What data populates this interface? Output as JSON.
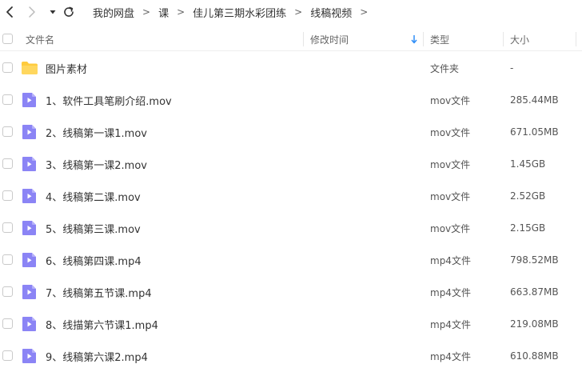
{
  "breadcrumb": [
    "我的网盘",
    "课",
    "佳儿第三期水彩团练",
    "线稿视频"
  ],
  "breadcrumb_sep": ">",
  "columns": {
    "name": "文件名",
    "modified": "修改时间",
    "type": "类型",
    "size": "大小"
  },
  "sort_column": "modified",
  "colors": {
    "folder": "#ffcb3d",
    "video": "#8b84f5",
    "sort_arrow": "#2f8ef7"
  },
  "files": [
    {
      "name": "图片素材",
      "type": "文件夹",
      "size": "-",
      "icon": "folder-icon"
    },
    {
      "name": "1、软件工具笔刷介绍.mov",
      "type": "mov文件",
      "size": "285.44MB",
      "icon": "video-file-icon"
    },
    {
      "name": "2、线稿第一课1.mov",
      "type": "mov文件",
      "size": "671.05MB",
      "icon": "video-file-icon"
    },
    {
      "name": "3、线稿第一课2.mov",
      "type": "mov文件",
      "size": "1.45GB",
      "icon": "video-file-icon"
    },
    {
      "name": "4、线稿第二课.mov",
      "type": "mov文件",
      "size": "2.52GB",
      "icon": "video-file-icon"
    },
    {
      "name": "5、线稿第三课.mov",
      "type": "mov文件",
      "size": "2.15GB",
      "icon": "video-file-icon"
    },
    {
      "name": "6、线稿第四课.mp4",
      "type": "mp4文件",
      "size": "798.52MB",
      "icon": "video-file-icon"
    },
    {
      "name": "7、线稿第五节课.mp4",
      "type": "mp4文件",
      "size": "663.87MB",
      "icon": "video-file-icon"
    },
    {
      "name": "8、线描第六节课1.mp4",
      "type": "mp4文件",
      "size": "219.08MB",
      "icon": "video-file-icon"
    },
    {
      "name": "9、线稿第六课2.mp4",
      "type": "mp4文件",
      "size": "610.88MB",
      "icon": "video-file-icon"
    }
  ]
}
